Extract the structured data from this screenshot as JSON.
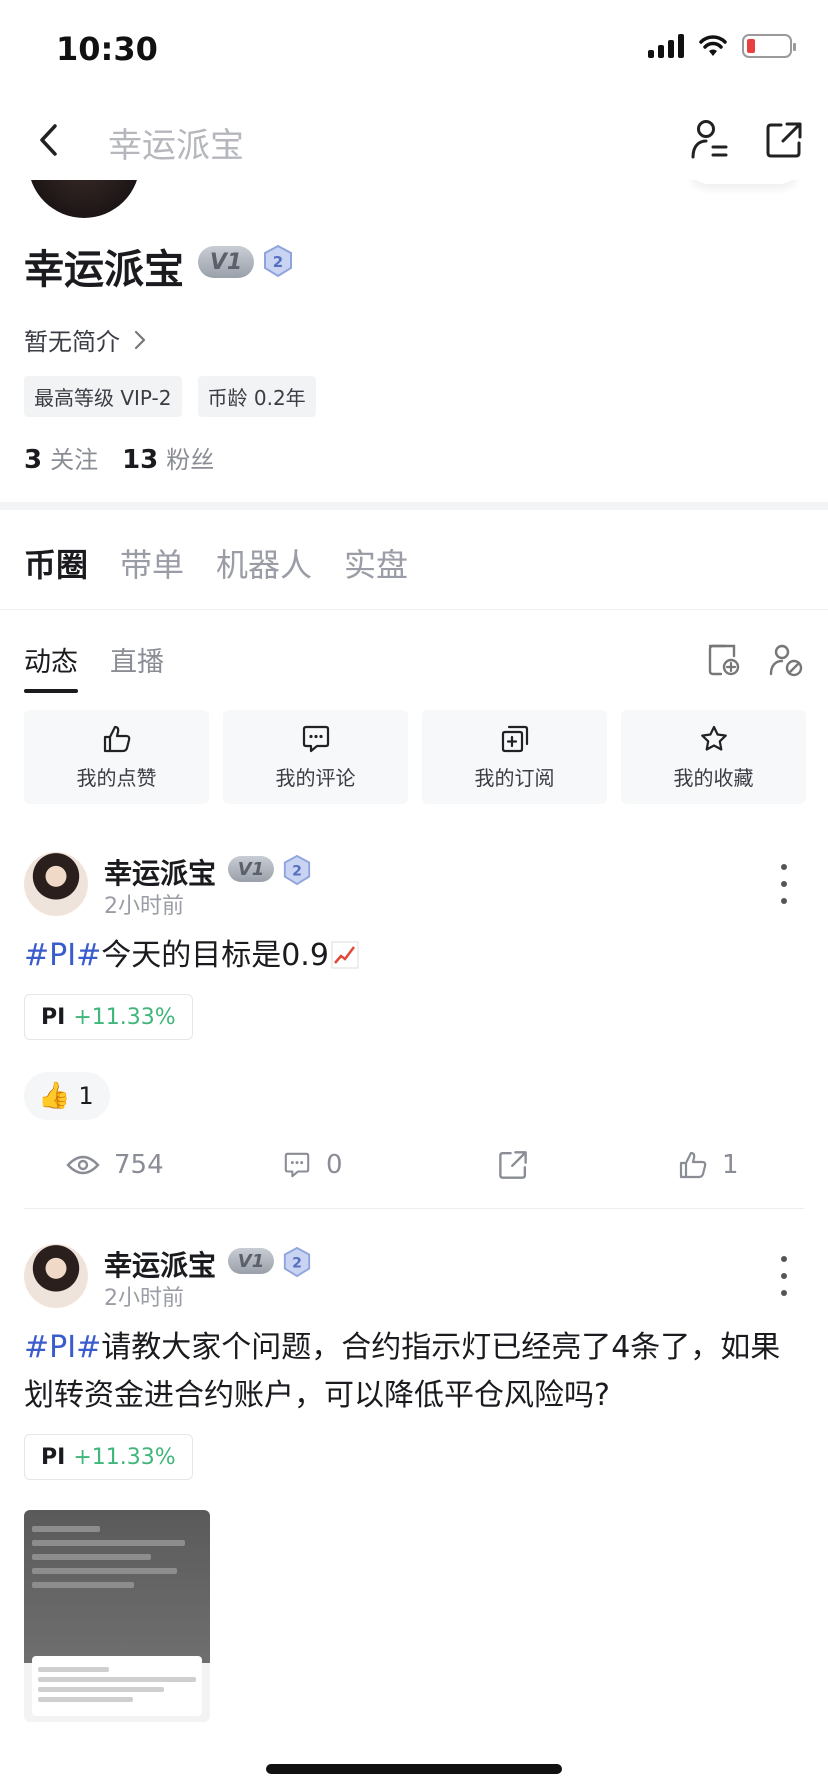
{
  "status_bar": {
    "time": "10:30"
  },
  "nav": {
    "title": "幸运派宝"
  },
  "profile": {
    "name": "幸运派宝",
    "vip_badge": "V1",
    "level_badge": "2",
    "bio": "暂无简介",
    "tags": [
      "最高等级 VIP-2",
      "币龄 0.2年"
    ],
    "following_count": "3",
    "following_label": "关注",
    "followers_count": "13",
    "followers_label": "粉丝"
  },
  "main_tabs": [
    "币圈",
    "带单",
    "机器人",
    "实盘"
  ],
  "sub_tabs": [
    "动态",
    "直播"
  ],
  "quick_actions": [
    "我的点赞",
    "我的评论",
    "我的订阅",
    "我的收藏"
  ],
  "posts": [
    {
      "author": "幸运派宝",
      "badge": "V1",
      "level": "2",
      "time": "2小时前",
      "hashtag": "#PI#",
      "text": "今天的目标是0.9",
      "coin": {
        "symbol": "PI",
        "change": "+11.33%"
      },
      "reaction": {
        "emoji": "👍",
        "count": "1"
      },
      "stats": {
        "views": "754",
        "comments": "0",
        "likes": "1"
      }
    },
    {
      "author": "幸运派宝",
      "badge": "V1",
      "level": "2",
      "time": "2小时前",
      "hashtag": "#PI#",
      "text": "请教大家个问题，合约指示灯已经亮了4条了，如果划转资金进合约账户，可以降低平仓风险吗?",
      "coin": {
        "symbol": "PI",
        "change": "+11.33%"
      }
    }
  ],
  "colors": {
    "hashtag": "#3a5ccc",
    "gain": "#3fb67a",
    "battery_low": "#e8403f"
  }
}
